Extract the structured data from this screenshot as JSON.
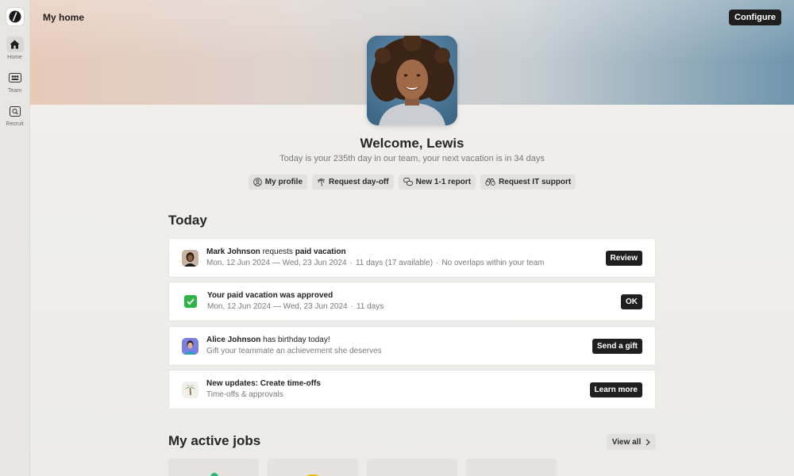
{
  "header": {
    "title": "My home",
    "configure_label": "Configure"
  },
  "sidebar": {
    "items": [
      {
        "label": "Home",
        "icon": "home-icon",
        "active": true
      },
      {
        "label": "Team",
        "icon": "team-icon",
        "active": false
      },
      {
        "label": "Recruit",
        "icon": "recruit-icon",
        "active": false
      }
    ]
  },
  "welcome": {
    "title": "Welcome, Lewis",
    "subtitle": "Today is your 235th day in our team, your next vacation is in 34 days"
  },
  "quick_actions": [
    {
      "label": "My profile",
      "icon": "user-circle-icon"
    },
    {
      "label": "Request day-off",
      "icon": "palm-tree-icon"
    },
    {
      "label": "New 1-1 report",
      "icon": "chat-bubbles-icon"
    },
    {
      "label": "Request IT support",
      "icon": "binoculars-icon"
    }
  ],
  "today": {
    "title": "Today",
    "items": [
      {
        "name": "Mark Johnson",
        "middle": " requests ",
        "bold2": "paid vacation",
        "details": [
          "Mon, 12 Jun 2024 — Wed, 23 Jun 2024",
          "11 days (17 available)",
          "No overlaps within your team"
        ],
        "action": "Review",
        "icon": "avatar-mark"
      },
      {
        "name": "Your paid vacation was approved",
        "middle": "",
        "bold2": "",
        "details": [
          "Mon, 12 Jun 2024 — Wed, 23 Jun 2024",
          "11 days"
        ],
        "action": "OK",
        "icon": "check-icon"
      },
      {
        "name": "Alice Johnson",
        "middle": " has birthday today!",
        "bold2": "",
        "details": [
          "Gift your teammate an achievement she deserves"
        ],
        "action": "Send a gift",
        "icon": "avatar-alice"
      },
      {
        "name": "New updates: Create time-offs",
        "middle": "",
        "bold2": "",
        "details": [
          "Time-offs & approvals"
        ],
        "action": "Learn more",
        "icon": "palm-tree-icon"
      }
    ]
  },
  "jobs": {
    "title": "My active jobs",
    "view_all_label": "View all"
  },
  "colors": {
    "accent": "#1f1f1f",
    "check_green": "#2fb24a"
  }
}
